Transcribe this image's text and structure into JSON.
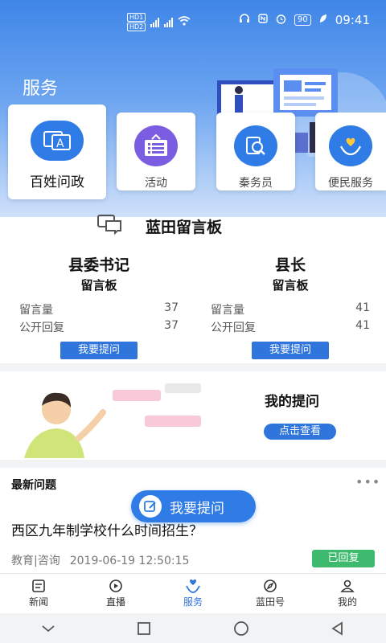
{
  "status": {
    "time": "09:41",
    "battery": "90"
  },
  "header": {
    "title": "服务"
  },
  "services": [
    {
      "label": "百姓问政",
      "icon": "chat-a-icon"
    },
    {
      "label": "活动",
      "icon": "list-sign-icon"
    },
    {
      "label": "秦务员",
      "icon": "search-doc-icon"
    },
    {
      "label": "便民服务",
      "icon": "heart-hand-icon"
    }
  ],
  "board": {
    "title": "蓝田留言板",
    "cards": [
      {
        "title": "县委书记",
        "subtitle": "留言板",
        "msg_label": "留言量",
        "msg_count": "37",
        "reply_label": "公开回复",
        "reply_count": "37",
        "button": "我要提问"
      },
      {
        "title": "县长",
        "subtitle": "留言板",
        "msg_label": "留言量",
        "msg_count": "41",
        "reply_label": "公开回复",
        "reply_count": "41",
        "button": "我要提问"
      }
    ]
  },
  "my_questions": {
    "title": "我的提问",
    "button": "点击查看"
  },
  "latest": {
    "title": "最新问题",
    "more": "•••",
    "question": "西区九年制学校什么时间招生？",
    "category": "教育|咨询",
    "date": "2019-06-19 12:50:15",
    "status": "已回复"
  },
  "float_button": "我要提问",
  "tabs": [
    {
      "label": "新闻",
      "icon": "news-icon"
    },
    {
      "label": "直播",
      "icon": "live-icon"
    },
    {
      "label": "服务",
      "icon": "service-icon",
      "active": true
    },
    {
      "label": "蓝田号",
      "icon": "compass-icon"
    },
    {
      "label": "我的",
      "icon": "user-icon"
    }
  ],
  "colors": {
    "primary": "#2f75dc",
    "success": "#3dba6e"
  }
}
